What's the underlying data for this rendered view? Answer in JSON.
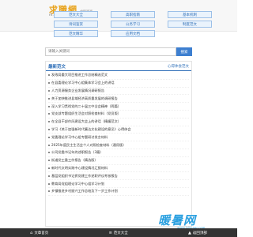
{
  "header": {
    "logo_text": "求職網",
    "logo_sub": "求职资源",
    "logo_url": "m.9reveal.com",
    "categories": [
      {
        "label": "范文大全"
      },
      {
        "label": "高职指南"
      },
      {
        "label": "基本机制"
      },
      {
        "label": "诗词鉴赏"
      },
      {
        "label": "公务学习"
      },
      {
        "label": "制度范文"
      },
      {
        "label": "范文精华"
      },
      {
        "label": "应用文档"
      }
    ]
  },
  "search": {
    "placeholder": "请输入关键词",
    "button_label": "搜索"
  },
  "section": {
    "title": "最新范文",
    "more_label": "心得体会范文",
    "items": [
      {
        "text": "发改局重大项目推进工作总结精选范文"
      },
      {
        "text": "在县委理论学习中心组集体学习会上的讲话"
      },
      {
        "text": "人力资源服务企业发展情况调研报告"
      },
      {
        "text": "关于加快推进县域经济高质量发展的调研报告"
      },
      {
        "text": "深入学习贯彻党的二十届三中全会精神（两篇）"
      },
      {
        "text": "党支部专题组织生活会对照检查材料（党员版）"
      },
      {
        "text": "在全县干部作风建设大会上的讲话（精编范文）"
      },
      {
        "text": "学习《关于加强新时代廉洁文化建设的意见》心得体会"
      },
      {
        "text": "党委理论学习中心组专题研讨发言材料"
      },
      {
        "text": "2025年度民主生活会个人对照检查材料（通用版）"
      },
      {
        "text": "公司党委书记年终述职报告（3篇）"
      },
      {
        "text": "街道党工委工作报告（精选版）"
      },
      {
        "text": "新时代文明实践中心建设情况汇报材料"
      },
      {
        "text": "基层党组织书记抓党建工作述职评议考核报告"
      },
      {
        "text": "教育局党组理论学习中心组学习计划"
      },
      {
        "text": "乡镇推进乡村振兴工作总结及下一步工作计划"
      }
    ]
  },
  "watermark": {
    "text": "暖暑网",
    "url": "www.juhuaer.com"
  },
  "footer": {
    "items": [
      {
        "label": "文章首页",
        "icon": "home-icon"
      },
      {
        "label": "范文大全",
        "icon": "list-icon"
      },
      {
        "label": "返回顶部",
        "icon": "arrow-up-icon"
      }
    ]
  }
}
